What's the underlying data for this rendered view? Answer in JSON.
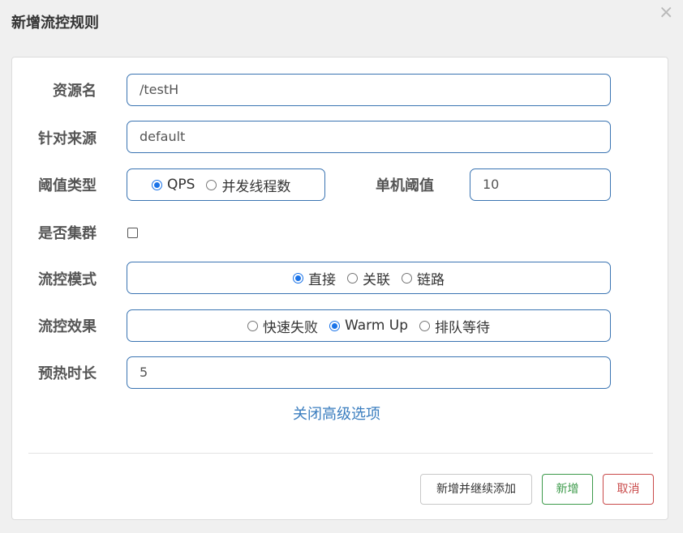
{
  "dialog": {
    "title": "新增流控规则",
    "close_glyph": "×"
  },
  "form": {
    "resource": {
      "label": "资源名",
      "value": "/testH"
    },
    "limit_app": {
      "label": "针对来源",
      "value": "default"
    },
    "threshold_type": {
      "label": "阈值类型",
      "options": [
        "QPS",
        "并发线程数"
      ],
      "selected": "QPS"
    },
    "single_threshold": {
      "label": "单机阈值",
      "value": "10"
    },
    "cluster": {
      "label": "是否集群",
      "checked": false
    },
    "flow_mode": {
      "label": "流控模式",
      "options": [
        "直接",
        "关联",
        "链路"
      ],
      "selected": "直接"
    },
    "flow_effect": {
      "label": "流控效果",
      "options": [
        "快速失败",
        "Warm Up",
        "排队等待"
      ],
      "selected": "Warm Up"
    },
    "warmup": {
      "label": "预热时长",
      "value": "5"
    },
    "advanced_toggle": "关闭高级选项"
  },
  "footer": {
    "add_continue": "新增并继续添加",
    "add": "新增",
    "cancel": "取消"
  },
  "colors": {
    "accent": "#3a74b2",
    "radio_checked": "#1a73e8",
    "success": "#3c9a4a",
    "danger": "#c94a4a",
    "link": "#3a7dbf"
  }
}
